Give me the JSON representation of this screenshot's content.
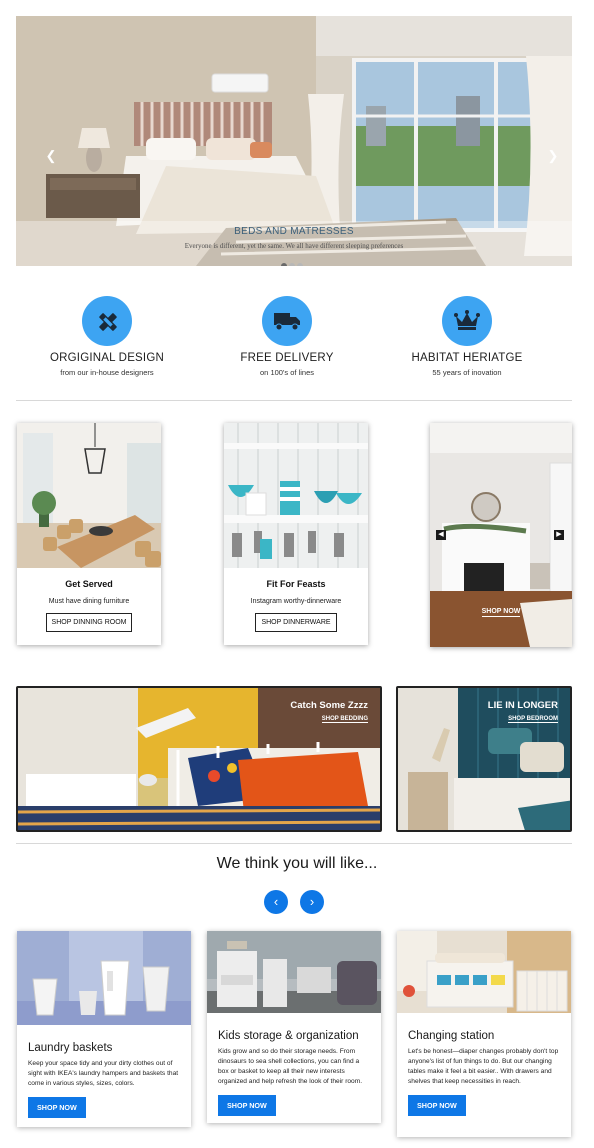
{
  "hero": {
    "title": "BEDS AND MATRESSES",
    "subtitle": "Everyone is different, yet the same. We all have different sleeping preferences",
    "prev_icon": "chevron-left",
    "next_icon": "chevron-right",
    "slide_count": 3,
    "active_slide": 1
  },
  "features": [
    {
      "icon": "pencil-ruler-icon",
      "title": "ORGIGINAL DESIGN",
      "subtitle": "from our in-house designers"
    },
    {
      "icon": "truck-icon",
      "title": "FREE DELIVERY",
      "subtitle": "on 100's of lines"
    },
    {
      "icon": "crown-icon",
      "title": "HABITAT HERIATGE",
      "subtitle": "55 years of inovation"
    }
  ],
  "product_cards": [
    {
      "title": "Get Served",
      "subtitle": "Must have dining furniture",
      "button": "SHOP DINNING ROOM"
    },
    {
      "title": "Fit For Feasts",
      "subtitle": "Instagram worthy-dinnerware",
      "button": "SHOP DINNERWARE"
    }
  ],
  "slider": {
    "link": "SHOP NOW",
    "prev_icon": "caret-left",
    "next_icon": "caret-right"
  },
  "banners": [
    {
      "title": "Catch Some Zzzz",
      "link": "SHOP BEDDING"
    },
    {
      "title": "LIE IN LONGER",
      "link": "SHOP BEDROOM"
    }
  ],
  "recommended": {
    "heading": "We think you will like...",
    "prev_icon": "chevron-left",
    "next_icon": "chevron-right",
    "cards": [
      {
        "title": "Laundry baskets",
        "description": "Keep your space tidy and your dirty clothes out of sight with IKEA's laundry hampers and baskets that come in various styles, sizes, colors.",
        "button": "SHOP NOW"
      },
      {
        "title": "Kids storage & organization",
        "description": "Kids grow and so do their storage needs. From dinosaurs to sea shell collections, you can find a box or basket to keep all their new interests organized and help refresh the look of their room.",
        "button": "SHOP NOW"
      },
      {
        "title": "Changing station",
        "description": "Let's be honest—diaper changes probably don't top anyone's list of fun things to do. But our changing tables make it feel a bit easier.. With drawers and shelves that keep necessities in reach.",
        "button": "SHOP NOW"
      }
    ]
  },
  "colors": {
    "accent_blue": "#3da4f2",
    "button_blue": "#0e77e6"
  }
}
